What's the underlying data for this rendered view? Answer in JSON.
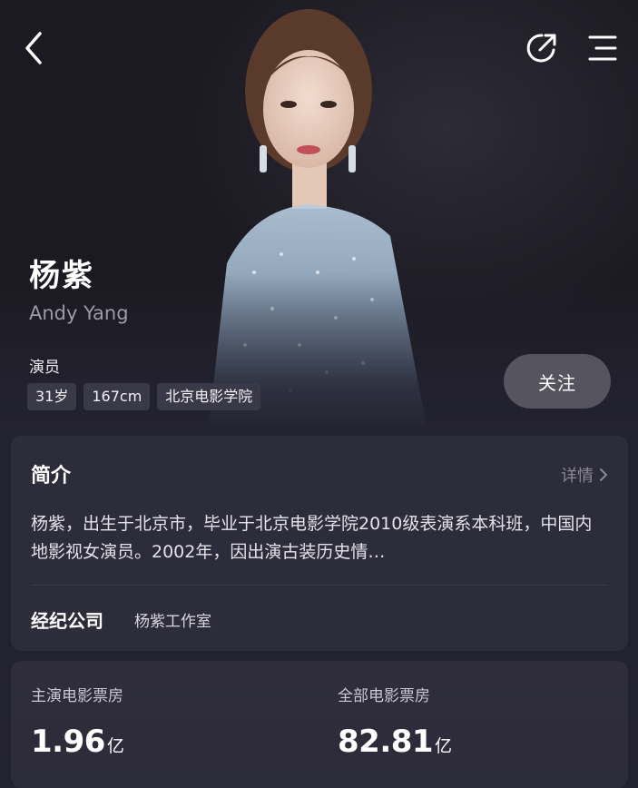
{
  "profile": {
    "name": "杨紫",
    "english_name": "Andy Yang",
    "role": "演员",
    "tags": [
      "31岁",
      "167cm",
      "北京电影学院"
    ],
    "follow_label": "关注"
  },
  "intro": {
    "title": "简介",
    "detail_label": "详情",
    "bio": "杨紫，出生于北京市，毕业于北京电影学院2010级表演系本科班，中国内地影视女演员。2002年，因出演古装历史情…",
    "agency_label": "经纪公司",
    "agency_value": "杨紫工作室"
  },
  "box_office": {
    "lead": {
      "label": "主演电影票房",
      "value": "1.96",
      "unit": "亿"
    },
    "total": {
      "label": "全部电影票房",
      "value": "82.81",
      "unit": "亿"
    }
  },
  "icons": {
    "back": "chevron-left-icon",
    "share": "share-icon",
    "menu": "menu-icon",
    "detail": "chevron-right-icon"
  },
  "colors": {
    "background": "#23222f",
    "card": "#2d2c3a",
    "tag": "#3a3947",
    "follow_button": "#55545f",
    "muted_text": "#9c9aa7"
  }
}
